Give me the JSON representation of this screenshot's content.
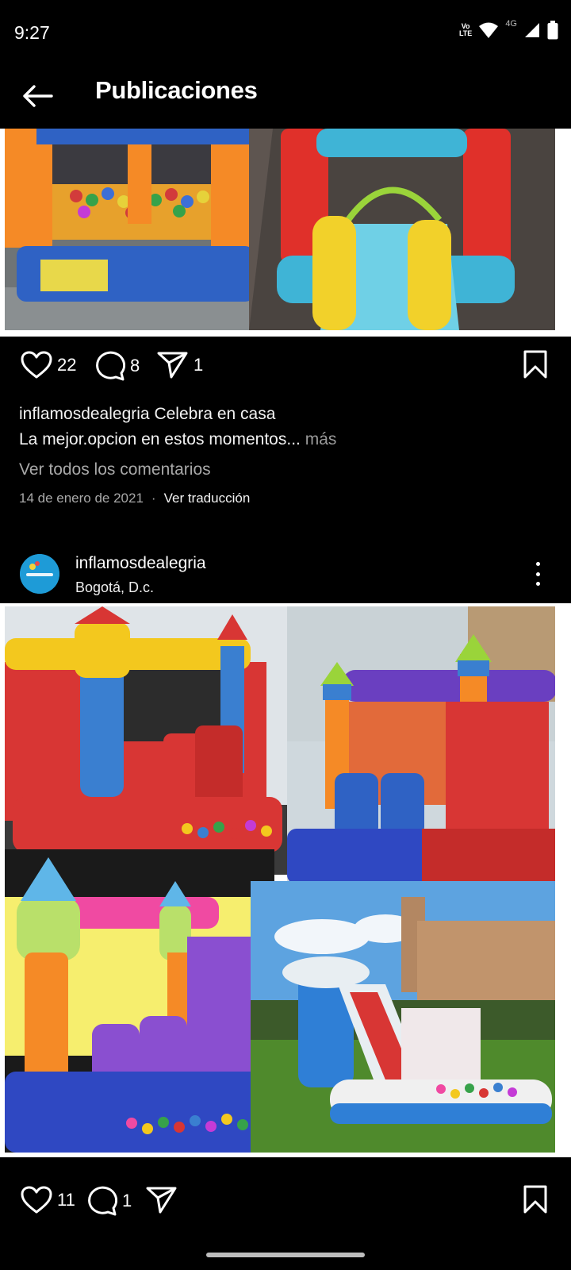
{
  "status_bar": {
    "time": "9:27",
    "volte_top": "Vo",
    "volte_bottom": "LTE",
    "network": "4G"
  },
  "header": {
    "title": "Publicaciones"
  },
  "post1": {
    "likes": "22",
    "comments": "8",
    "shares": "1",
    "caption_username": "inflamosdealegria",
    "caption_text": "Celebra en casa",
    "caption_line2": "La mejor.opcion en estos momentos...",
    "more_label": "más",
    "view_comments": "Ver todos los comentarios",
    "date": "14 de enero de 2021",
    "separator": "·",
    "translate": "Ver traducción"
  },
  "post2": {
    "username": "inflamosdealegria",
    "location": "Bogotá, D.c.",
    "likes": "11",
    "comments": "1"
  },
  "colors": {
    "background": "#000000",
    "text": "#ffffff",
    "muted": "#a8a8a8",
    "avatar": "#1e9bd7"
  }
}
